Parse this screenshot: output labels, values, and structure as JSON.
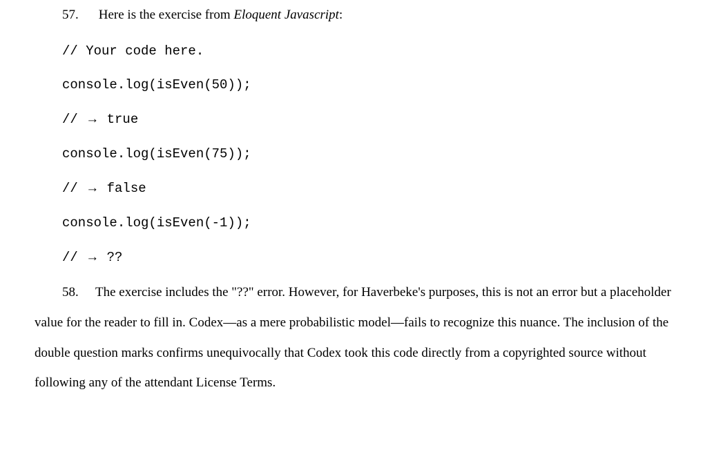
{
  "paragraphs": {
    "p57": {
      "number": "57.",
      "text_before_em": "Here is the exercise from ",
      "em_text": "Eloquent Javascript",
      "text_after_em": ":"
    },
    "p58": {
      "number": "58.",
      "text": "The exercise includes the \"??\" error. However, for Haverbeke's purposes, this is not an error but a placeholder value for the reader to fill in. Codex—as a mere probabilistic model—fails to recognize this nuance. The inclusion of the double question marks confirms unequivocally that Codex took this code directly from a copyrighted source without following any of the attendant License Terms."
    }
  },
  "code": {
    "l1": "// Your code here.",
    "blank": " ",
    "l2": "console.log(isEven(50));",
    "l3_pre": "// ",
    "arrow": "→",
    "l3_post": " true",
    "l4": "console.log(isEven(75));",
    "l5_post": " false",
    "l6": "console.log(isEven(-1));",
    "l7_post": " ??"
  }
}
